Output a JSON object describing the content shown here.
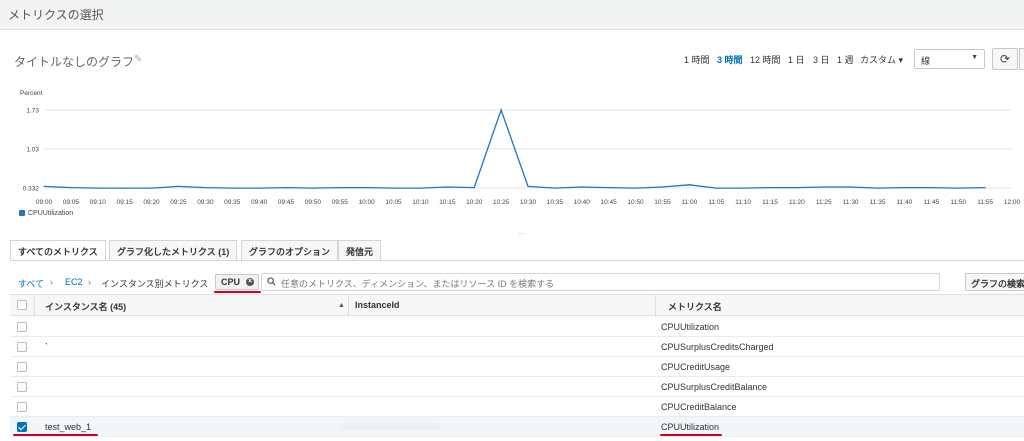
{
  "header": {
    "title": "メトリクスの選択"
  },
  "graph": {
    "title": "タイトルなしのグラフ",
    "edit_icon": "pencil-icon",
    "time_ranges": [
      "1 時間",
      "3 時間",
      "12 時間",
      "1 日",
      "3 日",
      "1 週",
      "カスタム ▾"
    ],
    "active_range": "3 時間",
    "chart_type": "線",
    "refresh_icon": "refresh-icon"
  },
  "chart_data": {
    "type": "line",
    "ylabel": "Percent",
    "y_ticks": [
      "1.73",
      "1.03",
      "0.332"
    ],
    "ylim": [
      0.332,
      1.73
    ],
    "x_ticks": [
      "09:00",
      "09:05",
      "09:10",
      "09:15",
      "09:20",
      "09:25",
      "09:30",
      "09:35",
      "09:40",
      "09:45",
      "09:50",
      "09:55",
      "10:00",
      "10:05",
      "10:10",
      "10:15",
      "10:20",
      "10:25",
      "10:30",
      "10:35",
      "10:40",
      "10:45",
      "10:50",
      "10:55",
      "11:00",
      "11:05",
      "11:10",
      "11:15",
      "11:20",
      "11:25",
      "11:30",
      "11:35",
      "11:40",
      "11:45",
      "11:50",
      "11:55",
      "12:00"
    ],
    "series": [
      {
        "name": "CPUUtilization",
        "color": "#1f77b4",
        "values": [
          0.36,
          0.34,
          0.33,
          0.33,
          0.33,
          0.36,
          0.34,
          0.33,
          0.33,
          0.34,
          0.33,
          0.34,
          0.34,
          0.33,
          0.33,
          0.35,
          0.34,
          1.73,
          0.36,
          0.33,
          0.35,
          0.34,
          0.33,
          0.35,
          0.39,
          0.33,
          0.33,
          0.34,
          0.34,
          0.35,
          0.35,
          0.33,
          0.34,
          0.34,
          0.33,
          0.34
        ]
      }
    ],
    "grid": true,
    "legend": "bottom-left"
  },
  "tabs": [
    {
      "label": "すべてのメトリクス",
      "active": true
    },
    {
      "label": "グラフ化したメトリクス (1)",
      "active": false
    },
    {
      "label": "グラフのオプション",
      "active": false
    },
    {
      "label": "発信元",
      "active": false
    }
  ],
  "filter": {
    "breadcrumb": [
      "すべて",
      "EC2",
      "インスタンス別メトリクス"
    ],
    "token": "CPU",
    "placeholder": "任意のメトリクス、ディメンション、またはリソース ID を検索する",
    "graph_search_label": "グラフの検索"
  },
  "table": {
    "columns": [
      "インスタンス名 (45)",
      "InstanceId",
      "メトリクス名"
    ],
    "rows": [
      {
        "instance_name": "",
        "metric": "CPUUtilization",
        "checked": false
      },
      {
        "instance_name": "`",
        "metric": "CPUSurplusCreditsCharged",
        "checked": false
      },
      {
        "instance_name": "",
        "metric": "CPUCreditUsage",
        "checked": false
      },
      {
        "instance_name": "",
        "metric": "CPUSurplusCreditBalance",
        "checked": false
      },
      {
        "instance_name": "",
        "metric": "CPUCreditBalance",
        "checked": false
      },
      {
        "instance_name": "test_web_1",
        "metric": "CPUUtilization",
        "checked": true
      }
    ]
  }
}
